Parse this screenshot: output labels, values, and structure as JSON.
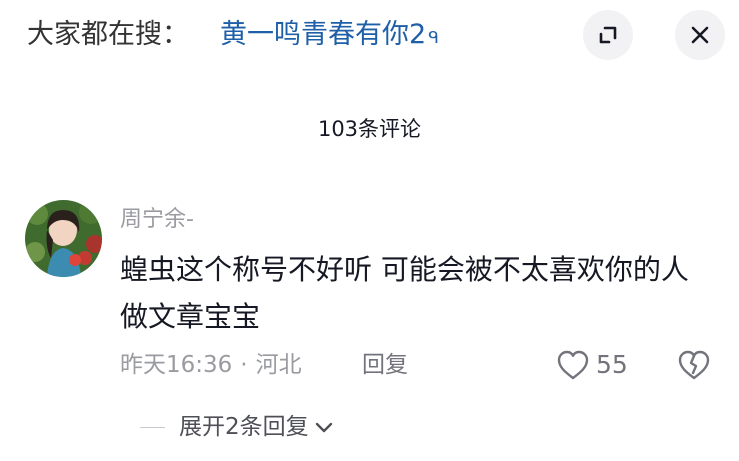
{
  "search": {
    "prefix": "大家都在搜：",
    "term": "黄一鸣青春有你2",
    "search_glyph": "ᑫ"
  },
  "header": {
    "comments_count": "103条评论"
  },
  "comment": {
    "username": "周宁余-",
    "text": "蝗虫这个称号不好听 可能会被不太喜欢你的人 做文章宝宝",
    "time": "昨天16:36",
    "separator": "·",
    "location": "河北",
    "reply_label": "回复",
    "like_count": "55"
  },
  "replies": {
    "expand_label": "展开2条回复"
  },
  "colors": {
    "link": "#1f5fa8",
    "muted": "#9a9ba1",
    "text": "#161823",
    "button_bg": "#f2f2f4"
  },
  "icons": [
    "search-icon",
    "expand-icon",
    "close-icon",
    "heart-icon",
    "broken-heart-icon",
    "chevron-down-icon"
  ]
}
